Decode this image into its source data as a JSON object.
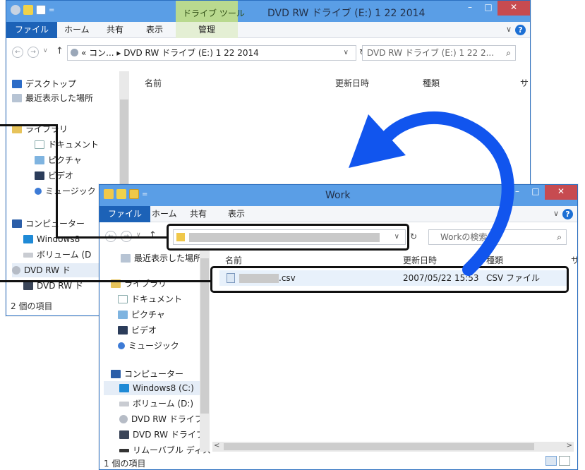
{
  "back_window": {
    "title": "DVD RW ドライブ (E:) 1 22 2014",
    "context_tab": "ドライブ ツール",
    "ribbon_tabs": [
      "ファイル",
      "ホーム",
      "共有",
      "表示",
      "管理"
    ],
    "address": "« コン... ▸ DVD RW ドライブ (E:) 1 22 2014",
    "search_placeholder": "DVD RW ドライブ (E:) 1 22 2...",
    "columns": [
      "名前",
      "更新日時",
      "種類",
      "サ"
    ],
    "tree": [
      "デスクトップ",
      "最近表示した場所",
      "ライブラリ",
      "ドキュメント",
      "ピクチャ",
      "ビデオ",
      "ミュージック",
      "コンピューター",
      "Windows8",
      "ボリューム (D",
      "DVD RW ド",
      "DVD RW ド"
    ],
    "status": "2 個の項目"
  },
  "front_window": {
    "title": "Work",
    "ribbon_tabs": [
      "ファイル",
      "ホーム",
      "共有",
      "表示"
    ],
    "search_placeholder": "Workの検索",
    "columns": [
      "名前",
      "更新日時",
      "種類",
      "サ"
    ],
    "tree": [
      "最近表示した場所",
      "ライブラリ",
      "ドキュメント",
      "ピクチャ",
      "ビデオ",
      "ミュージック",
      "コンピューター",
      "Windows8 (C:)",
      "ボリューム (D:)",
      "DVD RW ドライブ",
      "DVD RW ドライブ",
      "リムーバブル ディス"
    ],
    "file": {
      "ext": ".csv",
      "date": "2007/05/22 15:53",
      "type": "CSV ファイル"
    },
    "status": "1 個の項目"
  },
  "icons": {
    "help": "?",
    "refresh": "↻",
    "search": "⌕",
    "back": "←",
    "forward": "→",
    "up": "↑",
    "down": "∨",
    "minimize": "–",
    "maximize": "□",
    "close": "✕"
  },
  "colors": {
    "titlebar": "#5a9ee6",
    "file_tab": "#1c62b7",
    "close": "#c74b50",
    "arrow": "#1155ee"
  }
}
